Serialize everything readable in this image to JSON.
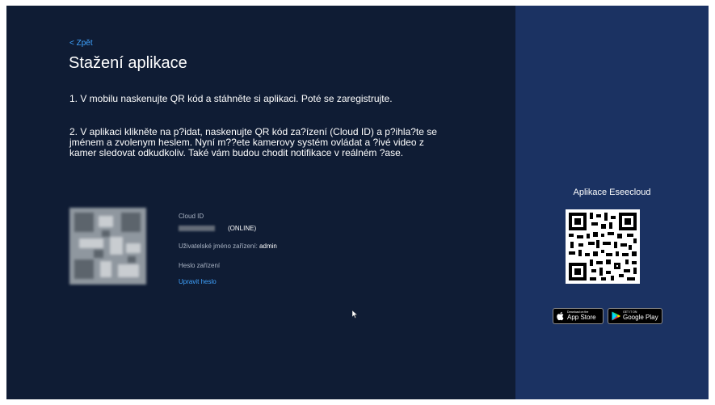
{
  "nav": {
    "back_label": "< Zpět"
  },
  "page": {
    "title": "Stažení aplikace",
    "step1": "1. V mobilu naskenujte QR kód a stáhněte si aplikaci. Poté se zaregistrujte.",
    "step2": "2. V aplikaci klikněte na p?idat, naskenujte QR kód za?ízení (Cloud ID) a p?ihla?te se jménem a zvolenym heslem. Nyní m??ete kamerovy systém ovládat a ?ivé video z kamer sledovat odkudkoliv. Také vám budou chodit notifikace v reálném ?ase."
  },
  "device": {
    "cloud_id_label": "Cloud ID",
    "status": "(ONLINE)",
    "username_label": "Uživatelské jméno zařízení: ",
    "username_value": "admin",
    "password_label": "Heslo zařízení",
    "change_password": "Upravit heslo"
  },
  "app": {
    "title": "Aplikace Eseecloud",
    "app_store": {
      "small": "Download on the",
      "big": "App Store"
    },
    "google_play": {
      "small": "GET IT ON",
      "big": "Google Play"
    }
  },
  "colors": {
    "left_bg": "#0f1c34",
    "right_bg": "#1b3262",
    "link": "#3fa3ff"
  }
}
